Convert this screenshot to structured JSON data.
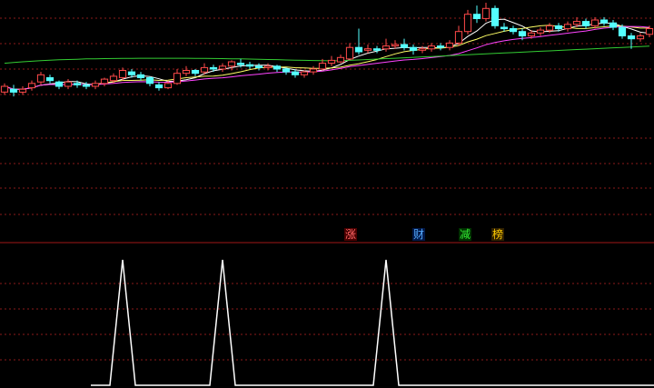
{
  "colors": {
    "background": "#000000",
    "grid": "#8b1a1a",
    "divider": "#a01818",
    "up_candle": "#ff4a4a",
    "down_candle": "#54ffff",
    "ma_fast": "#ffffff",
    "ma_mid": "#ffff66",
    "ma_slow": "#ff44ff",
    "ma_long": "#33cc33",
    "indicator_line": "#ffffff"
  },
  "labels": {
    "zhang": {
      "text": "涨",
      "color": "#ff6666",
      "bg": "#4a0000"
    },
    "cai": {
      "text": "财",
      "color": "#55aaff",
      "bg": "#001848"
    },
    "jian": {
      "text": "减",
      "color": "#33ee33",
      "bg": "#003000"
    },
    "bang": {
      "text": "榜",
      "color": "#ffcc00",
      "bg": "#302000"
    }
  },
  "chart_data": [
    {
      "type": "candlestick",
      "title": "",
      "grid": true,
      "ylim": [
        3,
        102
      ],
      "candles": [
        [
          40,
          44,
          38,
          46
        ],
        [
          42,
          40,
          37,
          45
        ],
        [
          40,
          42,
          38,
          44
        ],
        [
          43,
          46,
          41,
          48
        ],
        [
          47,
          52,
          45,
          54
        ],
        [
          50,
          48,
          46,
          52
        ],
        [
          47,
          44,
          42,
          48
        ],
        [
          44,
          47,
          42,
          49
        ],
        [
          46,
          45,
          43,
          48
        ],
        [
          45,
          44,
          42,
          47
        ],
        [
          44,
          46,
          42,
          48
        ],
        [
          46,
          49,
          44,
          50
        ],
        [
          48,
          51,
          46,
          53
        ],
        [
          50,
          55,
          48,
          57
        ],
        [
          54,
          52,
          50,
          56
        ],
        [
          52,
          50,
          48,
          54
        ],
        [
          50,
          46,
          44,
          51
        ],
        [
          45,
          43,
          41,
          47
        ],
        [
          43,
          46,
          42,
          48
        ],
        [
          46,
          53,
          45,
          56
        ],
        [
          53,
          55,
          51,
          58
        ],
        [
          55,
          53,
          51,
          56
        ],
        [
          54,
          57,
          52,
          60
        ],
        [
          57,
          56,
          54,
          59
        ],
        [
          56,
          58,
          54,
          60
        ],
        [
          58,
          61,
          55,
          62
        ],
        [
          60,
          59,
          57,
          63
        ],
        [
          59,
          58,
          56,
          61
        ],
        [
          58,
          57,
          55,
          60
        ],
        [
          57,
          58,
          55,
          60
        ],
        [
          58,
          56,
          54,
          59
        ],
        [
          56,
          54,
          52,
          57
        ],
        [
          54,
          52,
          50,
          56
        ],
        [
          52,
          54,
          50,
          55
        ],
        [
          54,
          56,
          52,
          58
        ],
        [
          56,
          60,
          55,
          63
        ],
        [
          60,
          62,
          58,
          65
        ],
        [
          61,
          64,
          60,
          66
        ],
        [
          63,
          71,
          62,
          74
        ],
        [
          71,
          68,
          66,
          84
        ],
        [
          69,
          70,
          67,
          73
        ],
        [
          70,
          69,
          67,
          72
        ],
        [
          70,
          72,
          68,
          77
        ],
        [
          72,
          73,
          70,
          76
        ],
        [
          73,
          71,
          69,
          77
        ],
        [
          71,
          69,
          66,
          73
        ],
        [
          69,
          70,
          67,
          72
        ],
        [
          70,
          72,
          68,
          74
        ],
        [
          72,
          71,
          69,
          74
        ],
        [
          71,
          74,
          69,
          76
        ],
        [
          74,
          82,
          72,
          86
        ],
        [
          82,
          94,
          80,
          97
        ],
        [
          94,
          91,
          88,
          100
        ],
        [
          91,
          98,
          89,
          102
        ],
        [
          98,
          86,
          84,
          100
        ],
        [
          85,
          84,
          82,
          88
        ],
        [
          84,
          82,
          80,
          86
        ],
        [
          82,
          79,
          76,
          84
        ],
        [
          79,
          81,
          77,
          83
        ],
        [
          81,
          83,
          79,
          85
        ],
        [
          83,
          86,
          81,
          88
        ],
        [
          86,
          84,
          82,
          88
        ],
        [
          84,
          87,
          82,
          89
        ],
        [
          87,
          89,
          85,
          92
        ],
        [
          89,
          86,
          84,
          91
        ],
        [
          86,
          90,
          84,
          92
        ],
        [
          90,
          88,
          86,
          92
        ],
        [
          88,
          85,
          83,
          90
        ],
        [
          85,
          79,
          77,
          87
        ],
        [
          79,
          77,
          70,
          81
        ],
        [
          77,
          79,
          75,
          81
        ],
        [
          80,
          84,
          78,
          86
        ]
      ],
      "moving_averages": [
        {
          "key": "ma_fast",
          "period": 5
        },
        {
          "key": "ma_mid",
          "period": 10
        },
        {
          "key": "ma_slow",
          "period": 20
        },
        {
          "key": "ma_long",
          "period": 60,
          "values": [
            60,
            60.5,
            61,
            61.4,
            61.8,
            62.1,
            62.4,
            62.6,
            62.8,
            63,
            63.1,
            63.2,
            63.3,
            63.4,
            63.4,
            63.5,
            63.5,
            63.5,
            63.5,
            63.5,
            63.5,
            63.4,
            63.4,
            63.3,
            63.2,
            63.1,
            63,
            62.9,
            62.8,
            62.6,
            62.5,
            62.3,
            62.1,
            62,
            61.9,
            61.8,
            61.7,
            61.8,
            62,
            62.3,
            62.6,
            62.9,
            63.2,
            63.5,
            63.8,
            64.1,
            64.4,
            64.7,
            65,
            65.3,
            65.6,
            65.9,
            66.2,
            66.5,
            66.8,
            67.1,
            67.4,
            67.7,
            68,
            68.3,
            68.6,
            68.9,
            69.2,
            69.5,
            69.8,
            70.1,
            70.4,
            70.7,
            71,
            71.3,
            71.6,
            71.9
          ]
        }
      ]
    },
    {
      "type": "line",
      "title": "",
      "grid": true,
      "ylim": [
        0,
        1
      ],
      "values": [
        0,
        0,
        0,
        0,
        0,
        0,
        0,
        0,
        0,
        0,
        0,
        0,
        0,
        0,
        0,
        0,
        0,
        0,
        0,
        0,
        0,
        0,
        0,
        0,
        0,
        0,
        0,
        0,
        0,
        0,
        0,
        0,
        0,
        0,
        0,
        0,
        0,
        0,
        0,
        0,
        0,
        0,
        0,
        0,
        0,
        0,
        0,
        0,
        0,
        0,
        0,
        0,
        0,
        0,
        0,
        0,
        0,
        0,
        0,
        0,
        0,
        0,
        0,
        0,
        0,
        0,
        0,
        0,
        0,
        0,
        0,
        0
      ],
      "spikes": [
        {
          "bar": 13,
          "value": 1
        },
        {
          "bar": 24,
          "value": 1
        },
        {
          "bar": 42,
          "value": 1
        }
      ]
    }
  ]
}
